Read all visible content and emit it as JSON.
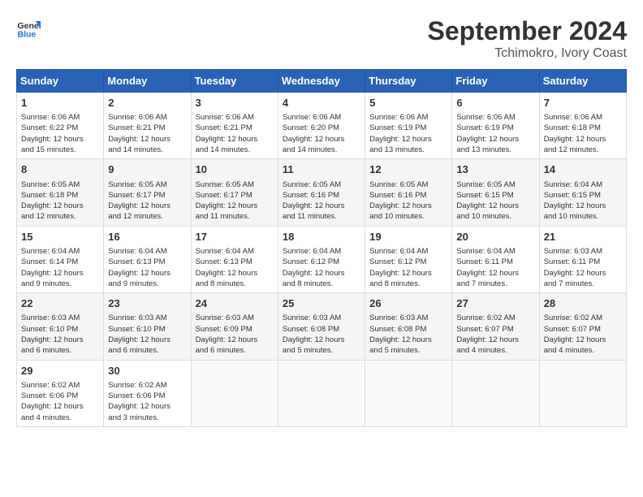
{
  "header": {
    "logo_line1": "General",
    "logo_line2": "Blue",
    "month": "September 2024",
    "location": "Tchimokro, Ivory Coast"
  },
  "weekdays": [
    "Sunday",
    "Monday",
    "Tuesday",
    "Wednesday",
    "Thursday",
    "Friday",
    "Saturday"
  ],
  "weeks": [
    [
      {
        "day": "1",
        "sunrise": "6:06 AM",
        "sunset": "6:22 PM",
        "daylight": "12 hours and 15 minutes."
      },
      {
        "day": "2",
        "sunrise": "6:06 AM",
        "sunset": "6:21 PM",
        "daylight": "12 hours and 14 minutes."
      },
      {
        "day": "3",
        "sunrise": "6:06 AM",
        "sunset": "6:21 PM",
        "daylight": "12 hours and 14 minutes."
      },
      {
        "day": "4",
        "sunrise": "6:06 AM",
        "sunset": "6:20 PM",
        "daylight": "12 hours and 14 minutes."
      },
      {
        "day": "5",
        "sunrise": "6:06 AM",
        "sunset": "6:19 PM",
        "daylight": "12 hours and 13 minutes."
      },
      {
        "day": "6",
        "sunrise": "6:06 AM",
        "sunset": "6:19 PM",
        "daylight": "12 hours and 13 minutes."
      },
      {
        "day": "7",
        "sunrise": "6:06 AM",
        "sunset": "6:18 PM",
        "daylight": "12 hours and 12 minutes."
      }
    ],
    [
      {
        "day": "8",
        "sunrise": "6:05 AM",
        "sunset": "6:18 PM",
        "daylight": "12 hours and 12 minutes."
      },
      {
        "day": "9",
        "sunrise": "6:05 AM",
        "sunset": "6:17 PM",
        "daylight": "12 hours and 12 minutes."
      },
      {
        "day": "10",
        "sunrise": "6:05 AM",
        "sunset": "6:17 PM",
        "daylight": "12 hours and 11 minutes."
      },
      {
        "day": "11",
        "sunrise": "6:05 AM",
        "sunset": "6:16 PM",
        "daylight": "12 hours and 11 minutes."
      },
      {
        "day": "12",
        "sunrise": "6:05 AM",
        "sunset": "6:16 PM",
        "daylight": "12 hours and 10 minutes."
      },
      {
        "day": "13",
        "sunrise": "6:05 AM",
        "sunset": "6:15 PM",
        "daylight": "12 hours and 10 minutes."
      },
      {
        "day": "14",
        "sunrise": "6:04 AM",
        "sunset": "6:15 PM",
        "daylight": "12 hours and 10 minutes."
      }
    ],
    [
      {
        "day": "15",
        "sunrise": "6:04 AM",
        "sunset": "6:14 PM",
        "daylight": "12 hours and 9 minutes."
      },
      {
        "day": "16",
        "sunrise": "6:04 AM",
        "sunset": "6:13 PM",
        "daylight": "12 hours and 9 minutes."
      },
      {
        "day": "17",
        "sunrise": "6:04 AM",
        "sunset": "6:13 PM",
        "daylight": "12 hours and 8 minutes."
      },
      {
        "day": "18",
        "sunrise": "6:04 AM",
        "sunset": "6:12 PM",
        "daylight": "12 hours and 8 minutes."
      },
      {
        "day": "19",
        "sunrise": "6:04 AM",
        "sunset": "6:12 PM",
        "daylight": "12 hours and 8 minutes."
      },
      {
        "day": "20",
        "sunrise": "6:04 AM",
        "sunset": "6:11 PM",
        "daylight": "12 hours and 7 minutes."
      },
      {
        "day": "21",
        "sunrise": "6:03 AM",
        "sunset": "6:11 PM",
        "daylight": "12 hours and 7 minutes."
      }
    ],
    [
      {
        "day": "22",
        "sunrise": "6:03 AM",
        "sunset": "6:10 PM",
        "daylight": "12 hours and 6 minutes."
      },
      {
        "day": "23",
        "sunrise": "6:03 AM",
        "sunset": "6:10 PM",
        "daylight": "12 hours and 6 minutes."
      },
      {
        "day": "24",
        "sunrise": "6:03 AM",
        "sunset": "6:09 PM",
        "daylight": "12 hours and 6 minutes."
      },
      {
        "day": "25",
        "sunrise": "6:03 AM",
        "sunset": "6:08 PM",
        "daylight": "12 hours and 5 minutes."
      },
      {
        "day": "26",
        "sunrise": "6:03 AM",
        "sunset": "6:08 PM",
        "daylight": "12 hours and 5 minutes."
      },
      {
        "day": "27",
        "sunrise": "6:02 AM",
        "sunset": "6:07 PM",
        "daylight": "12 hours and 4 minutes."
      },
      {
        "day": "28",
        "sunrise": "6:02 AM",
        "sunset": "6:07 PM",
        "daylight": "12 hours and 4 minutes."
      }
    ],
    [
      {
        "day": "29",
        "sunrise": "6:02 AM",
        "sunset": "6:06 PM",
        "daylight": "12 hours and 4 minutes."
      },
      {
        "day": "30",
        "sunrise": "6:02 AM",
        "sunset": "6:06 PM",
        "daylight": "12 hours and 3 minutes."
      },
      null,
      null,
      null,
      null,
      null
    ]
  ],
  "labels": {
    "sunrise": "Sunrise: ",
    "sunset": "Sunset: ",
    "daylight": "Daylight: "
  }
}
